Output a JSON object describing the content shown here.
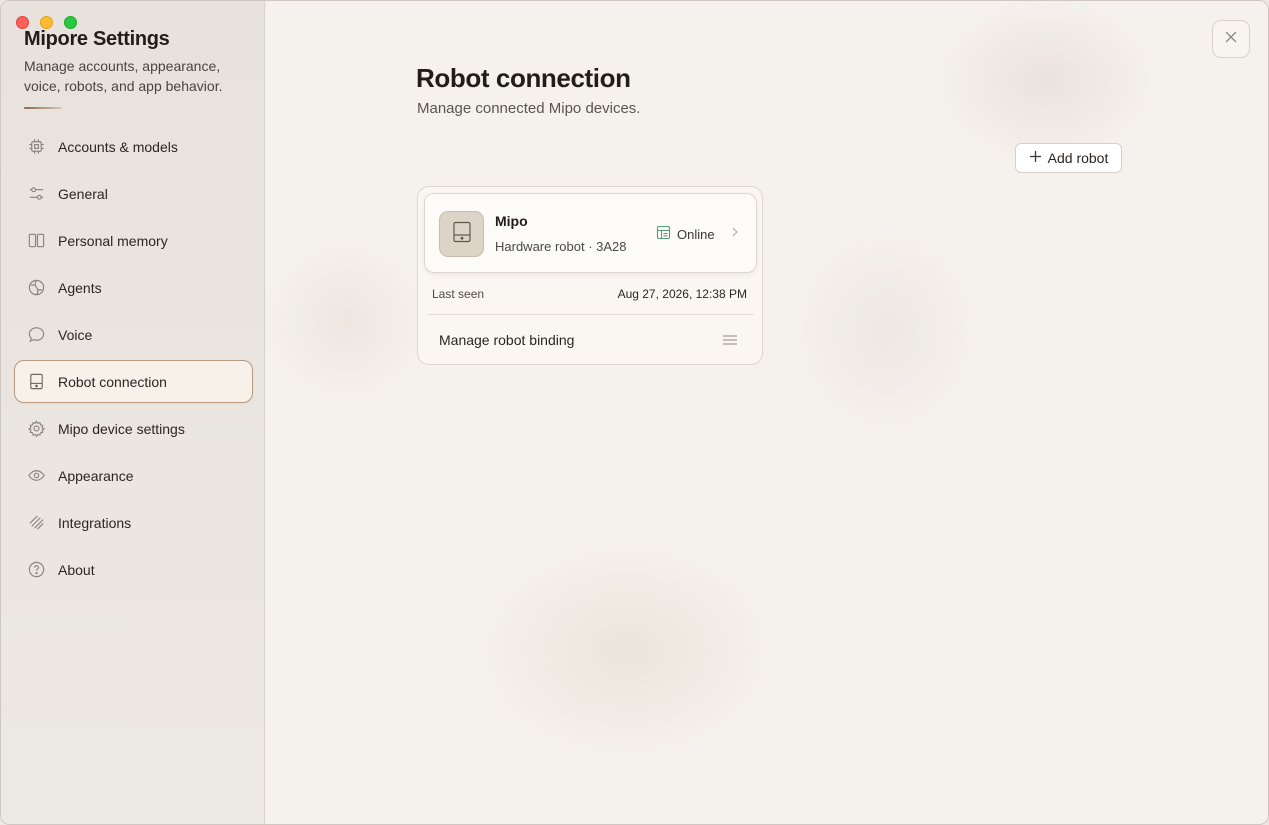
{
  "app": {
    "title": "Mipore Settings",
    "subtitle": "Manage accounts, appearance, voice, robots, and app behavior."
  },
  "sidebar": {
    "items": [
      {
        "label": "Accounts & models",
        "icon": "chip-icon"
      },
      {
        "label": "General",
        "icon": "sliders-icon"
      },
      {
        "label": "Personal memory",
        "icon": "book-icon"
      },
      {
        "label": "Agents",
        "icon": "agent-globe-icon"
      },
      {
        "label": "Voice",
        "icon": "speech-bubble-icon"
      },
      {
        "label": "Robot connection",
        "icon": "robot-device-icon",
        "active": true
      },
      {
        "label": "Mipo device settings",
        "icon": "gear-icon"
      },
      {
        "label": "Appearance",
        "icon": "eye-icon"
      },
      {
        "label": "Integrations",
        "icon": "integrations-icon"
      },
      {
        "label": "About",
        "icon": "help-circle-icon"
      }
    ]
  },
  "main": {
    "title": "Robot connection",
    "subtitle": "Manage connected Mipo devices.",
    "add_button": "Add robot",
    "robot": {
      "name": "Mipo",
      "meta": "Hardware robot · 3A28",
      "status": "Online",
      "last_seen_label": "Last seen",
      "last_seen_value": "Aug 27, 2026, 12:38 PM",
      "binding_label": "Manage robot binding"
    }
  },
  "colors": {
    "accent": "#b89a82",
    "status_online": "#5d9a76",
    "window_close": "#fe5f57",
    "window_minimize": "#febc2e",
    "window_maximize": "#28c840"
  }
}
